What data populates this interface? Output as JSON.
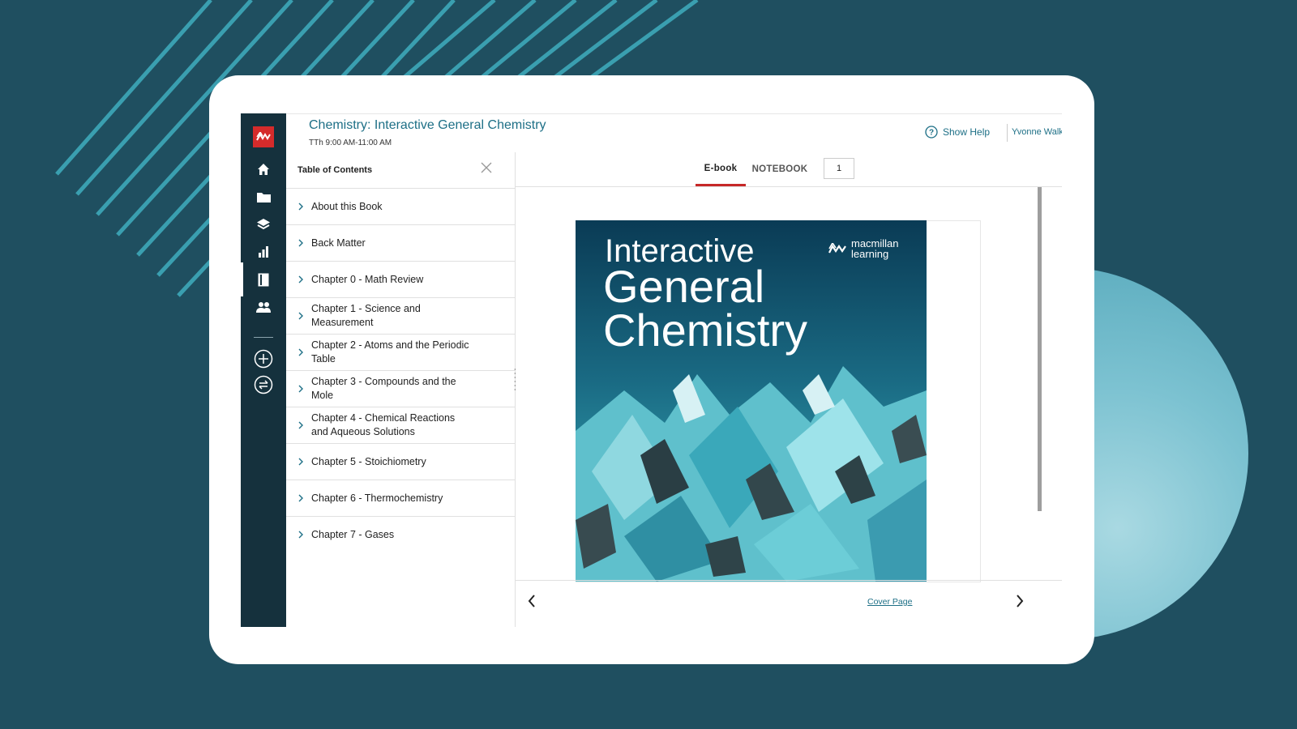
{
  "colors": {
    "accent": "#1d6f86",
    "brand_red": "#d52b2b",
    "rail": "#15313d",
    "tab_underline": "#c62828"
  },
  "header": {
    "course_title": "Chemistry: Interactive General Chemistry",
    "course_time": "TTh 9:00 AM-11:00 AM",
    "help_label": "Show Help",
    "user_name": "Yvonne Walker"
  },
  "rail": {
    "items": [
      {
        "icon": "home-icon"
      },
      {
        "icon": "folder-icon"
      },
      {
        "icon": "layers-icon"
      },
      {
        "icon": "bar-chart-icon"
      },
      {
        "icon": "book-icon",
        "active": true
      },
      {
        "icon": "people-icon"
      },
      {
        "icon": "add-circle-icon"
      },
      {
        "icon": "switch-icon"
      }
    ]
  },
  "toc": {
    "title": "Table of Contents",
    "items": [
      {
        "label": "About this Book"
      },
      {
        "label": "Back Matter"
      },
      {
        "label": "Chapter 0 - Math Review"
      },
      {
        "label": "Chapter 1 - Science and Measurement"
      },
      {
        "label": "Chapter 2 - Atoms and the Periodic Table"
      },
      {
        "label": "Chapter 3 - Compounds and the Mole"
      },
      {
        "label": "Chapter 4 - Chemical Reactions and Aqueous Solutions"
      },
      {
        "label": "Chapter 5 - Stoichiometry"
      },
      {
        "label": "Chapter 6 - Thermochemistry"
      },
      {
        "label": "Chapter 7 - Gases"
      }
    ]
  },
  "reader": {
    "tabs": [
      {
        "label": "E-book",
        "active": true
      },
      {
        "label": "NOTEBOOK"
      }
    ],
    "page_number": "1",
    "cover": {
      "line1": "Interactive",
      "line2": "General",
      "line3": "Chemistry",
      "brand": "macmillan\nlearning"
    },
    "footer_link": "Cover Page"
  }
}
